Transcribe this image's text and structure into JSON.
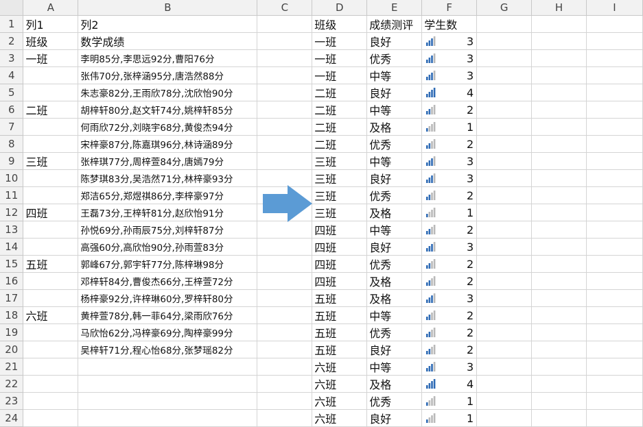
{
  "columns": [
    "A",
    "B",
    "C",
    "D",
    "E",
    "F",
    "G",
    "H",
    "I"
  ],
  "rows": [
    {
      "r": "1",
      "a": "列1",
      "b": "列2",
      "d": "班级",
      "e": "成绩测评",
      "f": "学生数",
      "fv": null
    },
    {
      "r": "2",
      "a": "班级",
      "b": "数学成绩",
      "d": "一班",
      "e": "良好",
      "f": "3",
      "fv": 3
    },
    {
      "r": "3",
      "a": "一班",
      "b": "李明85分,李思远92分,曹阳76分",
      "d": "一班",
      "e": "优秀",
      "f": "3",
      "fv": 3
    },
    {
      "r": "4",
      "a": "",
      "b": "张伟70分,张梓涵95分,唐浩然88分",
      "d": "一班",
      "e": "中等",
      "f": "3",
      "fv": 3
    },
    {
      "r": "5",
      "a": "",
      "b": "朱志豪82分,王雨欣78分,沈欣怡90分",
      "d": "二班",
      "e": "良好",
      "f": "4",
      "fv": 4
    },
    {
      "r": "6",
      "a": "二班",
      "b": "胡梓轩80分,赵文轩74分,姚梓轩85分",
      "d": "二班",
      "e": "中等",
      "f": "2",
      "fv": 2
    },
    {
      "r": "7",
      "a": "",
      "b": "何雨欣72分,刘晓宇68分,黄俊杰94分",
      "d": "二班",
      "e": "及格",
      "f": "1",
      "fv": 1
    },
    {
      "r": "8",
      "a": "",
      "b": "宋梓豪87分,陈嘉琪96分,林诗涵89分",
      "d": "二班",
      "e": "优秀",
      "f": "2",
      "fv": 2
    },
    {
      "r": "9",
      "a": "三班",
      "b": "张梓琪77分,周梓萱84分,唐嫣79分",
      "d": "三班",
      "e": "中等",
      "f": "3",
      "fv": 3
    },
    {
      "r": "10",
      "a": "",
      "b": "陈梦琪83分,吴浩然71分,林梓豪93分",
      "d": "三班",
      "e": "良好",
      "f": "3",
      "fv": 3
    },
    {
      "r": "11",
      "a": "",
      "b": "郑洁65分,郑煜祺86分,李梓豪97分",
      "d": "三班",
      "e": "优秀",
      "f": "2",
      "fv": 2
    },
    {
      "r": "12",
      "a": "四班",
      "b": "王磊73分,王梓轩81分,赵欣怡91分",
      "d": "三班",
      "e": "及格",
      "f": "1",
      "fv": 1
    },
    {
      "r": "13",
      "a": "",
      "b": "孙悦69分,孙雨辰75分,刘梓轩87分",
      "d": "四班",
      "e": "中等",
      "f": "2",
      "fv": 2
    },
    {
      "r": "14",
      "a": "",
      "b": "高强60分,高欣怡90分,孙雨萱83分",
      "d": "四班",
      "e": "良好",
      "f": "3",
      "fv": 3
    },
    {
      "r": "15",
      "a": "五班",
      "b": "郭峰67分,郭宇轩77分,陈梓琳98分",
      "d": "四班",
      "e": "优秀",
      "f": "2",
      "fv": 2
    },
    {
      "r": "16",
      "a": "",
      "b": "邓梓轩84分,曹俊杰66分,王梓萱72分",
      "d": "四班",
      "e": "及格",
      "f": "2",
      "fv": 2
    },
    {
      "r": "17",
      "a": "",
      "b": "杨梓豪92分,许梓琳60分,罗梓轩80分",
      "d": "五班",
      "e": "及格",
      "f": "3",
      "fv": 3
    },
    {
      "r": "18",
      "a": "六班",
      "b": "黄梓萱78分,韩一菲64分,梁雨欣76分",
      "d": "五班",
      "e": "中等",
      "f": "2",
      "fv": 2
    },
    {
      "r": "19",
      "a": "",
      "b": "马欣怡62分,冯梓豪69分,陶梓豪99分",
      "d": "五班",
      "e": "优秀",
      "f": "2",
      "fv": 2
    },
    {
      "r": "20",
      "a": "",
      "b": "吴梓轩71分,程心怡68分,张梦瑶82分",
      "d": "五班",
      "e": "良好",
      "f": "2",
      "fv": 2
    },
    {
      "r": "21",
      "a": "",
      "b": "",
      "d": "六班",
      "e": "中等",
      "f": "3",
      "fv": 3
    },
    {
      "r": "22",
      "a": "",
      "b": "",
      "d": "六班",
      "e": "及格",
      "f": "4",
      "fv": 4
    },
    {
      "r": "23",
      "a": "",
      "b": "",
      "d": "六班",
      "e": "优秀",
      "f": "1",
      "fv": 1
    },
    {
      "r": "24",
      "a": "",
      "b": "",
      "d": "六班",
      "e": "良好",
      "f": "1",
      "fv": 1
    }
  ],
  "colors": {
    "bar_on": "#2f6bb5",
    "bar_off": "#b9b9b9",
    "arrow": "#5b9bd5"
  },
  "icons": {
    "signal": "bar-signal-icon",
    "arrow": "right-arrow-icon"
  }
}
